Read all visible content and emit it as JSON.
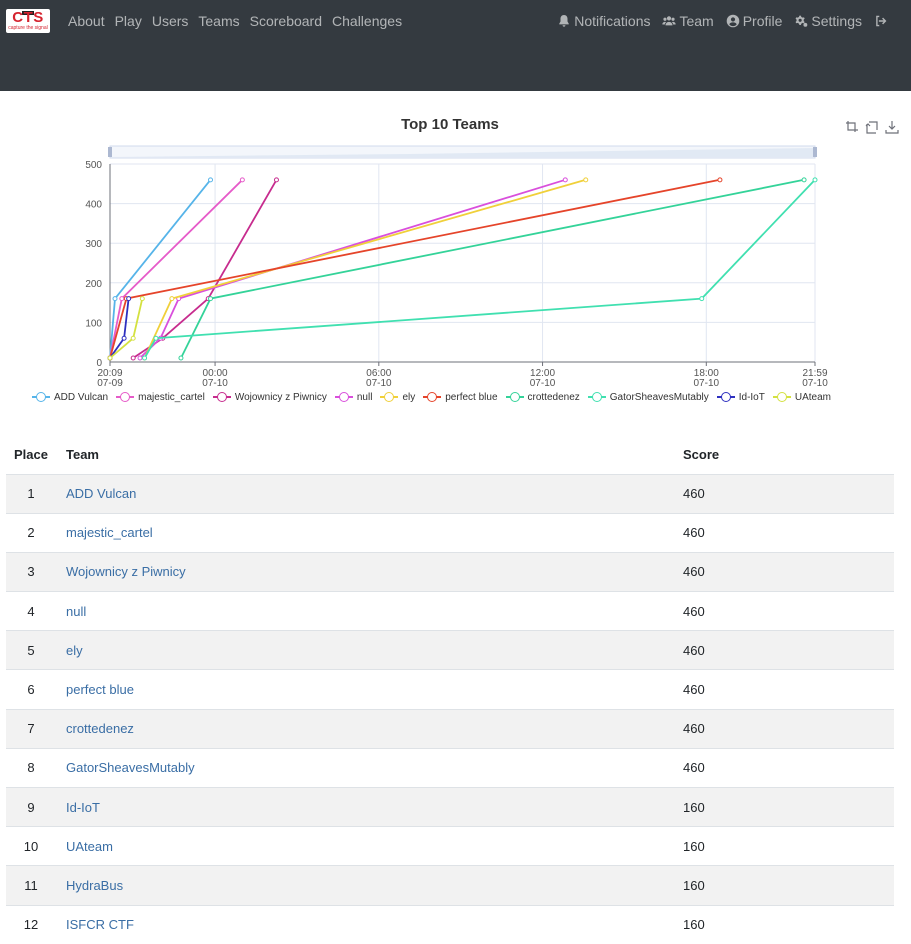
{
  "nav": {
    "brand": {
      "logo_text": "CTS",
      "tagline": "capture the signal"
    },
    "left": [
      "About",
      "Play",
      "Users",
      "Teams",
      "Scoreboard",
      "Challenges"
    ],
    "right": [
      {
        "label": "Notifications",
        "icon": "bell-icon"
      },
      {
        "label": "Team",
        "icon": "users-icon"
      },
      {
        "label": "Profile",
        "icon": "user-circle-icon"
      },
      {
        "label": "Settings",
        "icon": "gears-icon"
      },
      {
        "label": "",
        "icon": "logout-icon"
      }
    ]
  },
  "chart_data": {
    "type": "line",
    "title": "Top 10 Teams",
    "ylim": [
      0,
      500
    ],
    "yticks": [
      0,
      100,
      200,
      300,
      400,
      500
    ],
    "xrange": [
      "07-09 20:09",
      "07-10 21:59"
    ],
    "xticks": [
      {
        "top": "20:09",
        "bottom": "07-09",
        "t": "07-09 20:09"
      },
      {
        "top": "00:00",
        "bottom": "07-10",
        "t": "07-10 00:00"
      },
      {
        "top": "06:00",
        "bottom": "07-10",
        "t": "07-10 06:00"
      },
      {
        "top": "12:00",
        "bottom": "07-10",
        "t": "07-10 12:00"
      },
      {
        "top": "18:00",
        "bottom": "07-10",
        "t": "07-10 18:00"
      },
      {
        "top": "21:59",
        "bottom": "07-10",
        "t": "07-10 21:59"
      }
    ],
    "grid": true,
    "legend_position": "bottom",
    "series": [
      {
        "name": "ADD Vulcan",
        "color": "#56b4e9",
        "points": [
          [
            "07-09 20:09",
            10
          ],
          [
            "07-09 20:20",
            160
          ],
          [
            "07-09 23:50",
            460
          ]
        ]
      },
      {
        "name": "majestic_cartel",
        "color": "#e65bc9",
        "points": [
          [
            "07-09 20:09",
            10
          ],
          [
            "07-09 20:35",
            160
          ],
          [
            "07-10 01:00",
            460
          ]
        ]
      },
      {
        "name": "Wojownicy z Piwnicy",
        "color": "#c72c8e",
        "points": [
          [
            "07-09 21:00",
            10
          ],
          [
            "07-09 22:05",
            60
          ],
          [
            "07-09 23:45",
            160
          ],
          [
            "07-10 02:15",
            460
          ]
        ]
      },
      {
        "name": "null",
        "color": "#d94fdc",
        "points": [
          [
            "07-09 21:15",
            10
          ],
          [
            "07-09 22:00",
            60
          ],
          [
            "07-09 22:40",
            160
          ],
          [
            "07-10 12:50",
            460
          ]
        ]
      },
      {
        "name": "ely",
        "color": "#f0d03a",
        "points": [
          [
            "07-09 21:25",
            10
          ],
          [
            "07-09 22:25",
            160
          ],
          [
            "07-10 13:35",
            460
          ]
        ]
      },
      {
        "name": "perfect blue",
        "color": "#e5442a",
        "points": [
          [
            "07-09 20:09",
            10
          ],
          [
            "07-09 20:45",
            160
          ],
          [
            "07-10 18:30",
            460
          ]
        ]
      },
      {
        "name": "crottedenez",
        "color": "#34d399",
        "points": [
          [
            "07-09 22:45",
            10
          ],
          [
            "07-09 23:50",
            160
          ],
          [
            "07-10 21:35",
            460
          ]
        ]
      },
      {
        "name": "GatorSheavesMutably",
        "color": "#40e0b0",
        "points": [
          [
            "07-09 21:25",
            10
          ],
          [
            "07-09 21:50",
            60
          ],
          [
            "07-10 17:50",
            160
          ],
          [
            "07-10 21:59",
            460
          ]
        ]
      },
      {
        "name": "Id-IoT",
        "color": "#2d2fbf",
        "points": [
          [
            "07-09 20:09",
            10
          ],
          [
            "07-09 20:40",
            60
          ],
          [
            "07-09 20:50",
            160
          ]
        ]
      },
      {
        "name": "UAteam",
        "color": "#d4e140",
        "points": [
          [
            "07-09 20:09",
            10
          ],
          [
            "07-09 21:00",
            60
          ],
          [
            "07-09 21:20",
            160
          ]
        ]
      }
    ]
  },
  "table": {
    "headers": {
      "place": "Place",
      "team": "Team",
      "score": "Score"
    },
    "rows": [
      {
        "place": "1",
        "team": "ADD Vulcan",
        "score": "460"
      },
      {
        "place": "2",
        "team": "majestic_cartel",
        "score": "460"
      },
      {
        "place": "3",
        "team": "Wojownicy z Piwnicy",
        "score": "460"
      },
      {
        "place": "4",
        "team": "null",
        "score": "460"
      },
      {
        "place": "5",
        "team": "ely",
        "score": "460"
      },
      {
        "place": "6",
        "team": "perfect blue",
        "score": "460"
      },
      {
        "place": "7",
        "team": "crottedenez",
        "score": "460"
      },
      {
        "place": "8",
        "team": "GatorSheavesMutably",
        "score": "460"
      },
      {
        "place": "9",
        "team": "Id-IoT",
        "score": "160"
      },
      {
        "place": "10",
        "team": "UAteam",
        "score": "160"
      },
      {
        "place": "11",
        "team": "HydraBus",
        "score": "160"
      },
      {
        "place": "12",
        "team": "ISFCR CTF",
        "score": "160"
      }
    ]
  }
}
